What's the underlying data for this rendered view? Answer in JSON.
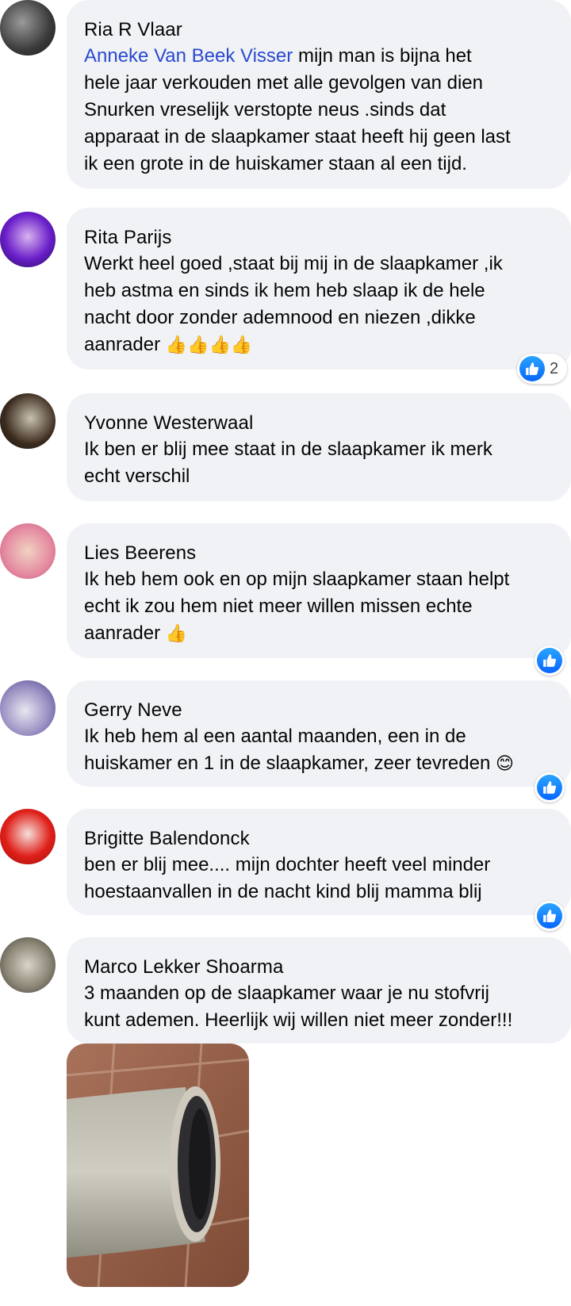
{
  "comments": [
    {
      "author": "Ria R Vlaar",
      "mention": "Anneke Van Beek Visser",
      "text": " mijn man is bijna het\nhele jaar verkouden met alle gevolgen van dien\nSnurken vreselijk verstopte neus .sinds dat\napparaat in de slaapkamer staat heeft hij geen last\nik een grote in de huiskamer staan al een tijd."
    },
    {
      "author": "Rita Parijs",
      "text": "Werkt heel goed ,staat bij mij in de slaapkamer ,ik\nheb astma en sinds ik hem heb slaap ik de hele\nnacht door zonder ademnood en niezen ,dikke\naanrader ",
      "emoji": "👍👍👍👍",
      "reaction_count": "2"
    },
    {
      "author": "Yvonne Westerwaal",
      "text": "Ik ben er blij mee staat in de slaapkamer ik merk\necht verschil"
    },
    {
      "author": "Lies Beerens",
      "text": "Ik heb hem ook en op mijn slaapkamer staan helpt\necht ik zou hem niet meer willen missen echte\naanrader ",
      "emoji": "👍"
    },
    {
      "author": "Gerry Neve",
      "text": "Ik heb hem al een aantal maanden, een in de\nhuiskamer en 1 in de slaapkamer, zeer tevreden ",
      "emoji": "😊"
    },
    {
      "author": "Brigitte Balendonck",
      "text": "ben er blij mee.... mijn dochter heeft veel minder\nhoestaanvallen in de nacht kind blij mamma blij"
    },
    {
      "author": "Marco Lekker Shoarma",
      "text": "3 maanden op de slaapkamer waar je nu stofvrij\nkunt ademen. Heerlijk wij willen niet meer zonder!!!"
    }
  ],
  "icons": {
    "like": "like-icon",
    "attachment": "photo-attachment"
  },
  "colors": {
    "bubble": "#f0f2f5",
    "mention": "#2a4ad0",
    "like": "#0866ff"
  }
}
